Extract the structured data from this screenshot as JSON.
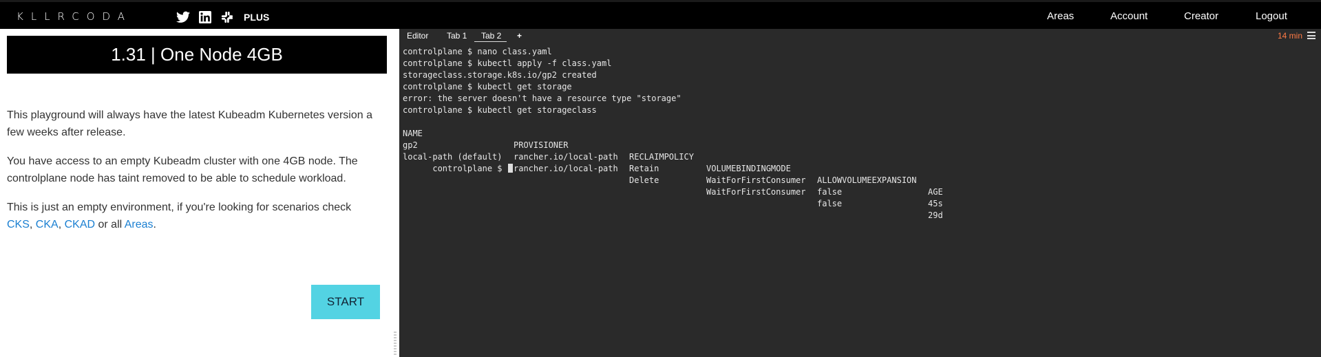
{
  "nav": {
    "logo": "KLLRCODA",
    "plus": "PLUS",
    "links": [
      "Areas",
      "Account",
      "Creator",
      "Logout"
    ]
  },
  "left": {
    "title": "1.31 | One Node 4GB",
    "p1": "This playground will always have the latest Kubeadm Kubernetes version a few weeks after release.",
    "p2": "You have access to an empty Kubeadm cluster with one 4GB node. The controlplane node has taint removed to be able to schedule workload.",
    "p3_prefix": "This is just an empty environment, if you're looking for scenarios check",
    "links": [
      "CKS",
      "CKA",
      "CKAD",
      "Areas"
    ],
    "sep1": ", ",
    "sep2": ", ",
    "sep3": " or all ",
    "end": ".",
    "start": "START"
  },
  "terminal": {
    "tabs": [
      "Editor",
      "Tab 1",
      "Tab 2"
    ],
    "add_tab": "+",
    "active_tab": "Tab 2",
    "timer": "14 min",
    "lines": [
      "controlplane $ nano class.yaml",
      "controlplane $ kubectl apply -f class.yaml",
      "storageclass.storage.k8s.io/gp2 created",
      "controlplane $ kubectl get storage",
      "error: the server doesn't have a resource type \"storage\"",
      "controlplane $ kubectl get storageclass"
    ],
    "table": {
      "headers": [
        "NAME",
        "PROVISIONER",
        "RECLAIMPOLICY",
        "VOLUMEBINDINGMODE",
        "ALLOWVOLUMEEXPANSION",
        "AGE"
      ],
      "rows": [
        [
          "gp2",
          "rancher.io/local-path",
          "Retain",
          "WaitForFirstConsumer",
          "false",
          "45s"
        ],
        [
          "local-path (default)",
          "rancher.io/local-path",
          "Delete",
          "WaitForFirstConsumer",
          "false",
          "29d"
        ]
      ]
    },
    "prompt": "controlplane $ "
  }
}
